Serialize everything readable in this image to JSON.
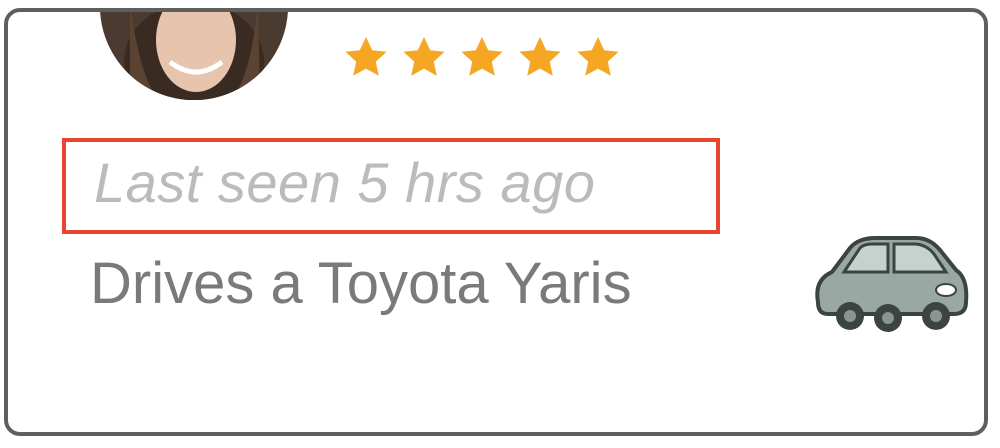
{
  "profile": {
    "avatar_icon": "user-avatar-photo",
    "rating": 5,
    "rating_max": 5,
    "star_color": "#f5a623"
  },
  "status": {
    "last_seen": "Last seen 5 hrs ago",
    "highlight_color": "#e8452f"
  },
  "vehicle": {
    "text": "Drives a Toyota Yaris",
    "icon": "car-icon"
  }
}
